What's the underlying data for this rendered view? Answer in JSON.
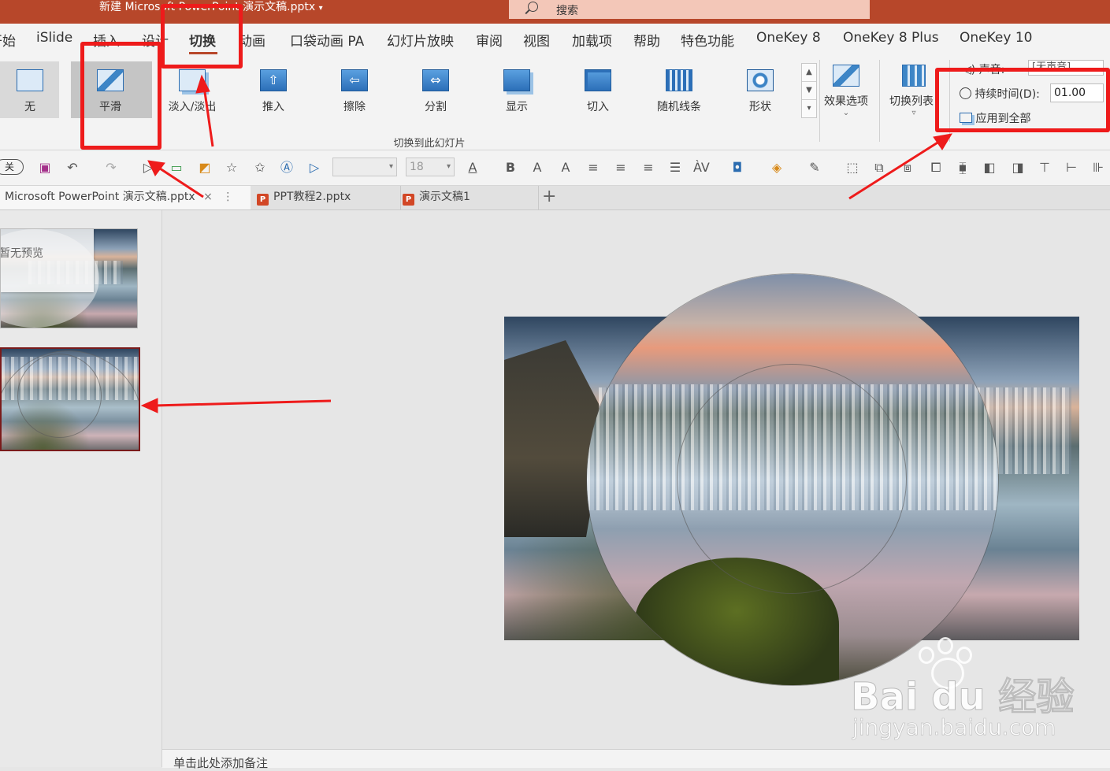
{
  "window": {
    "title": "新建 Microsoft PowerPoint 演示文稿.pptx",
    "title_caret": "▾",
    "search_placeholder": "搜索"
  },
  "menu": {
    "items": [
      "开始",
      "iSlide",
      "插入",
      "设计",
      "切换",
      "动画",
      "口袋动画 PA",
      "幻灯片放映",
      "审阅",
      "视图",
      "加载项",
      "帮助",
      "特色功能",
      "OneKey 8",
      "OneKey 8 Plus",
      "OneKey 10"
    ],
    "active": "切换"
  },
  "ribbon": {
    "transitions": [
      "无",
      "平滑",
      "淡入/淡出",
      "推入",
      "擦除",
      "分割",
      "显示",
      "切入",
      "随机线条",
      "形状"
    ],
    "selected_transition": "平滑",
    "group_label": "切换到此幻灯片",
    "effect_options": "效果选项",
    "transition_list": "切换列表",
    "timing": {
      "sound_label": "声音:",
      "sound_value": "[无声音]",
      "duration_label": "持续时间(D):",
      "duration_value": "01.00",
      "apply_all": "应用到全部"
    }
  },
  "quick_toolbar": {
    "toggle": "关",
    "font_size": "18"
  },
  "file_tabs": [
    {
      "name": "Microsoft PowerPoint 演示文稿.pptx",
      "active": true,
      "close": "×"
    },
    {
      "name": "PPT教程2.pptx",
      "active": false
    },
    {
      "name": "演示文稿1",
      "active": false
    }
  ],
  "new_tab_symbol": "+",
  "thumbnails": {
    "no_preview": "暂无预览"
  },
  "notes_placeholder": "单击此处添加备注",
  "watermark": {
    "logo": "Bai du 经验",
    "url": "jingyan.baidu.com"
  },
  "colors": {
    "accent": "#b7472a",
    "annotation": "#ee1b1b",
    "ribbon": "#f3f3f3"
  }
}
